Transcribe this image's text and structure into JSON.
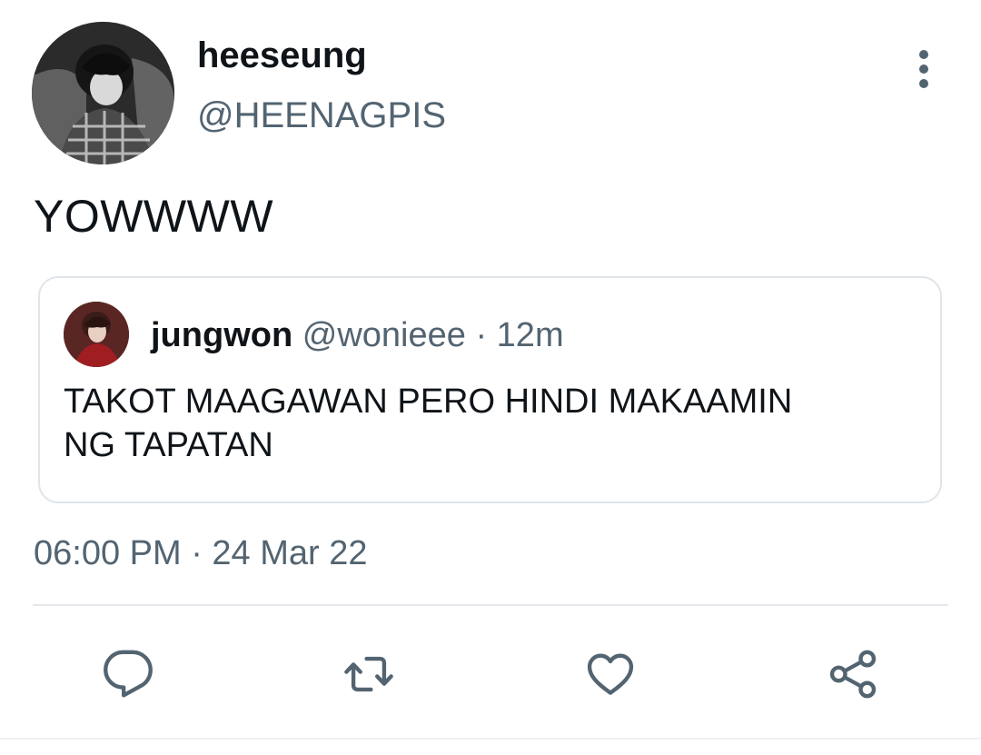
{
  "author": {
    "display_name": "heeseung",
    "handle": "@HEENAGPIS"
  },
  "tweet": {
    "text": "YOWWWW",
    "timestamp": "06:00 PM · 24 Mar 22"
  },
  "quoted_tweet": {
    "display_name": "jungwon",
    "handle": "@wonieee",
    "separator": "·",
    "time": "12m",
    "text": "TAKOT MAAGAWAN PERO HINDI  MAKAAMIN\nNG TAPATAN"
  },
  "actions": {
    "icons": [
      "reply-icon",
      "retweet-icon",
      "like-icon",
      "share-icon"
    ]
  },
  "colors": {
    "text_primary": "#0f1419",
    "text_secondary": "#536471",
    "icon": "#536471",
    "border": "#dfe5ea"
  }
}
